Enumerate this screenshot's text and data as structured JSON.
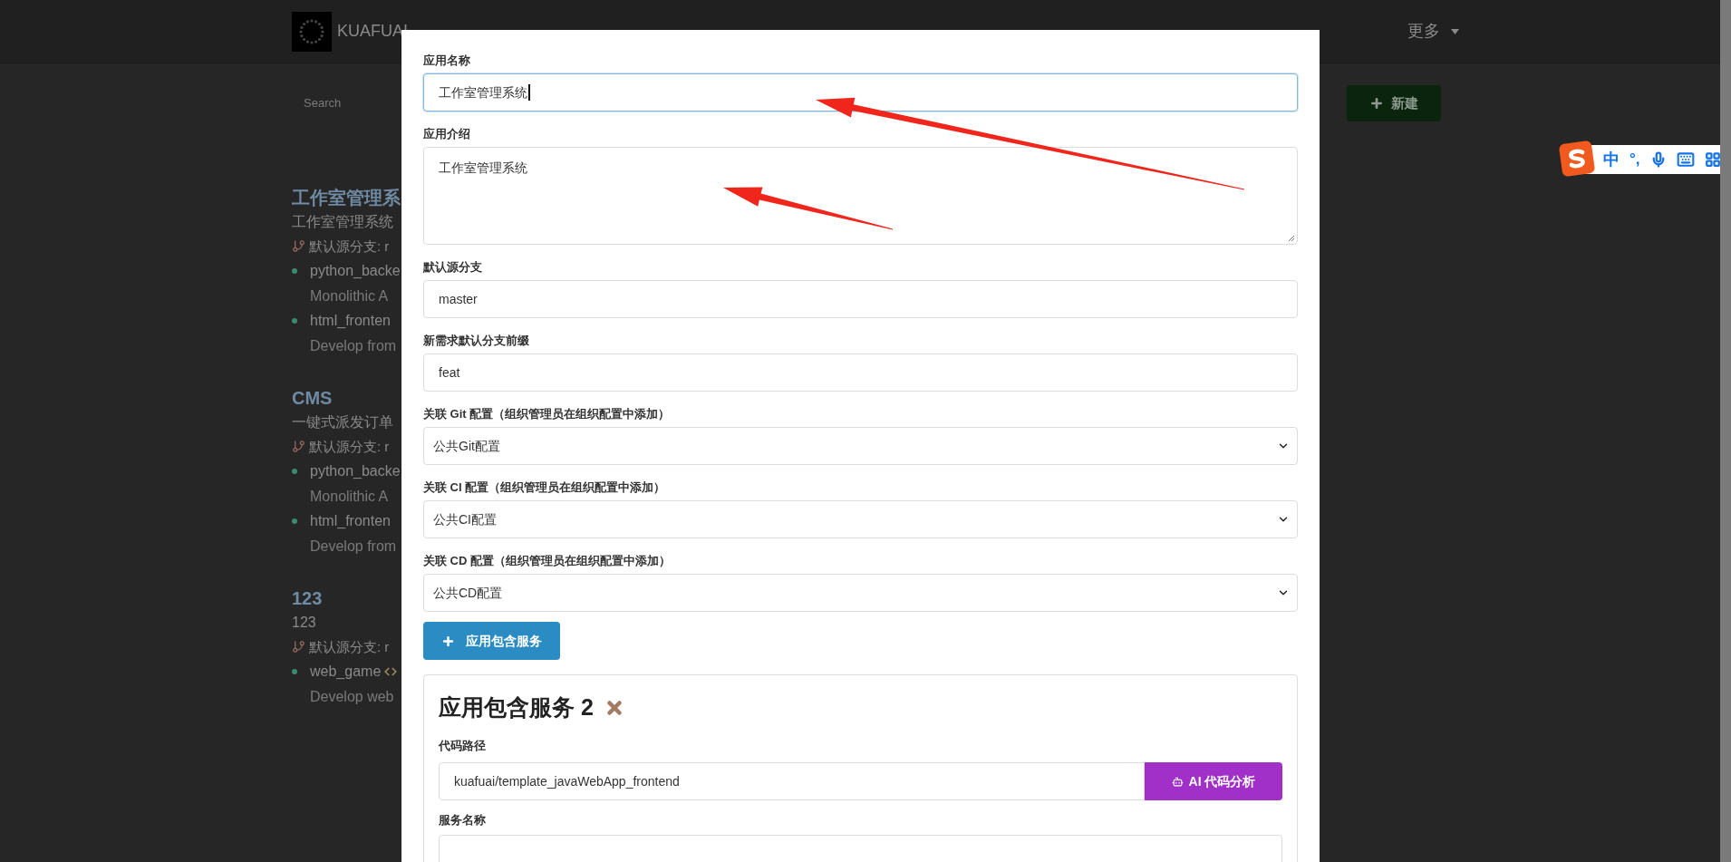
{
  "nav": {
    "brand": "KUAFUAI",
    "more": "更多"
  },
  "search": {
    "placeholder": "Search"
  },
  "new_button": "新建",
  "apps": [
    {
      "title": "工作室管理系",
      "description": "工作室管理系统",
      "branch": "默认源分支: r",
      "services": [
        {
          "name": "python_backe",
          "note": "Monolithic A",
          "code_icon": false
        },
        {
          "name": "html_fronten",
          "note": "Develop from",
          "code_icon": false
        }
      ]
    },
    {
      "title": "CMS",
      "description": "一键式派发订单",
      "branch": "默认源分支: r",
      "services": [
        {
          "name": "python_backe",
          "note": "Monolithic A",
          "code_icon": false
        },
        {
          "name": "html_fronten",
          "note": "Develop from",
          "code_icon": false
        }
      ]
    },
    {
      "title": "123",
      "description": "123",
      "branch": "默认源分支: r",
      "services": [
        {
          "name": "web_game",
          "note": "Develop web",
          "code_icon": true
        }
      ]
    }
  ],
  "form": {
    "fields": [
      {
        "kind": "input",
        "label": "应用名称",
        "value": "工作室管理系统",
        "focused": true
      },
      {
        "kind": "textarea",
        "label": "应用介绍",
        "value": "工作室管理系统",
        "focused": false
      },
      {
        "kind": "input",
        "label": "默认源分支",
        "value": "master",
        "focused": false
      },
      {
        "kind": "input",
        "label": "新需求默认分支前缀",
        "value": "feat",
        "focused": false
      },
      {
        "kind": "select",
        "label": "关联 Git 配置（组织管理员在组织配置中添加）",
        "value": "公共Git配置",
        "focused": false
      },
      {
        "kind": "select",
        "label": "关联 CI 配置（组织管理员在组织配置中添加）",
        "value": "公共CI配置",
        "focused": false
      },
      {
        "kind": "select",
        "label": "关联 CD 配置（组织管理员在组织配置中添加）",
        "value": "公共CD配置",
        "focused": false
      }
    ],
    "add_service_button": "应用包含服务",
    "service": {
      "title": "应用包含服务 2",
      "code_path_label": "代码路径",
      "code_path": "kuafuai/template_javaWebApp_frontend",
      "analyze_button": "AI 代码分析",
      "name_label": "服务名称"
    }
  },
  "ime": {
    "mode": "中",
    "punct": "°,"
  }
}
